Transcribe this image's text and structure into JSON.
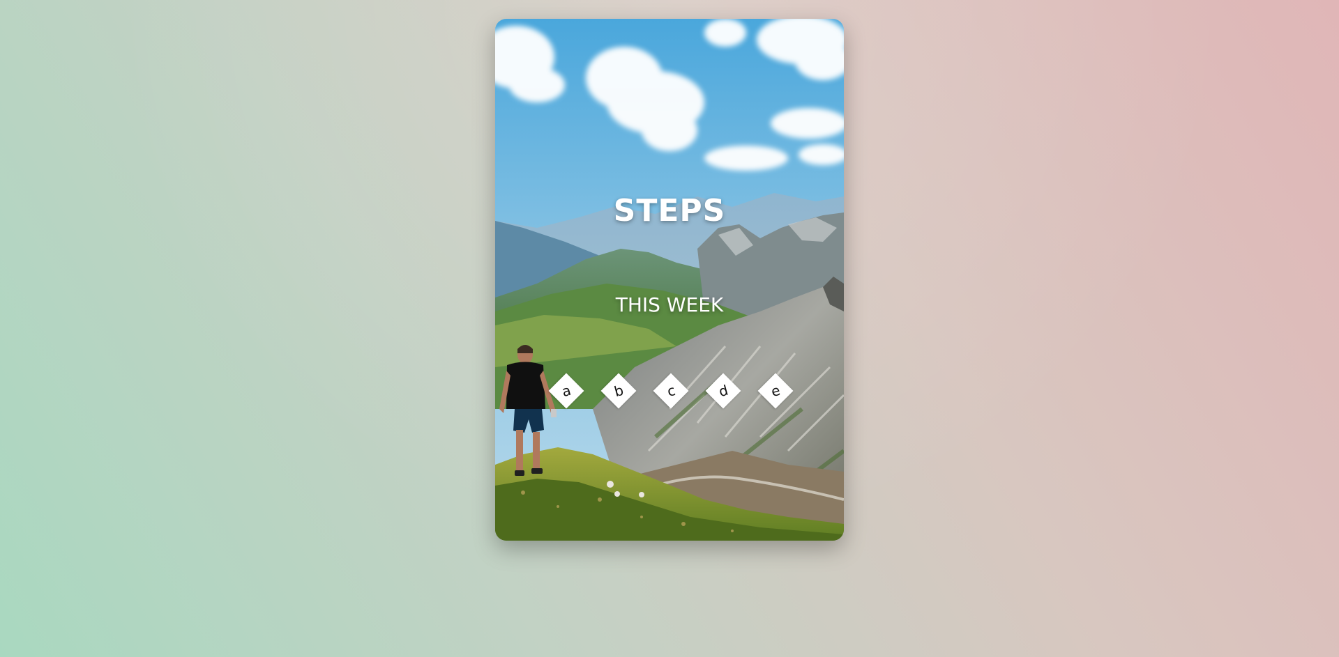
{
  "card": {
    "title": "STEPS",
    "subtitle": "THIS WEEK",
    "steps": [
      {
        "label": "a"
      },
      {
        "label": "b"
      },
      {
        "label": "c"
      },
      {
        "label": "d"
      },
      {
        "label": "e"
      }
    ]
  },
  "colors": {
    "background_left": "#a9d8c0",
    "background_right": "#e0b6b7",
    "text": "#ffffff",
    "diamond": "#ffffff"
  },
  "icons": {
    "background_photo": "mountain-landscape-hiker-image"
  }
}
